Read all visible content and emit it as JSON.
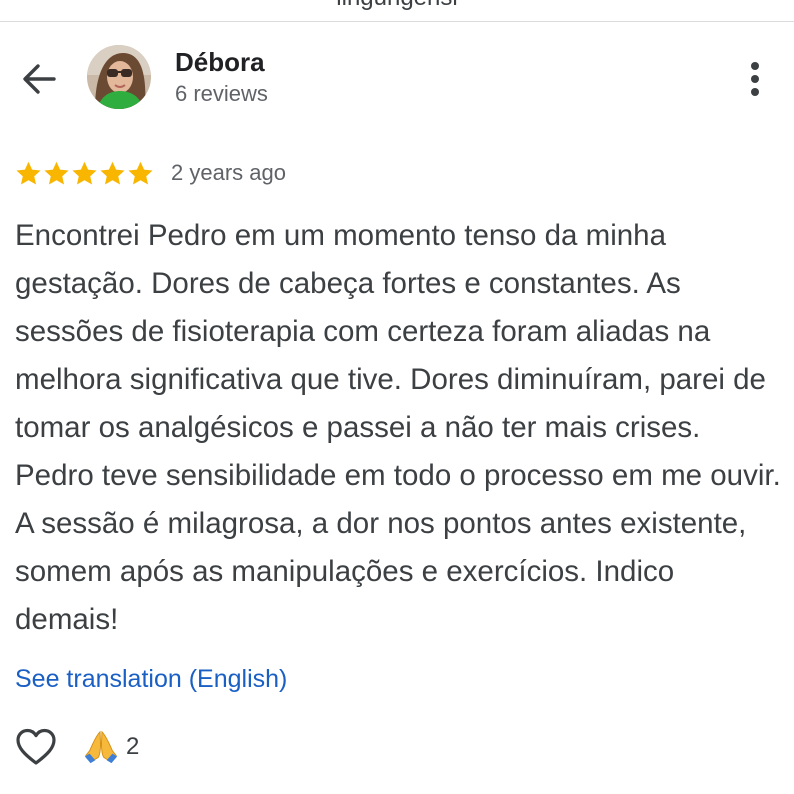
{
  "header": {
    "truncated_text": "lingungensi"
  },
  "reviewer": {
    "name": "Débora",
    "review_count": "6 reviews",
    "avatar_icon": "avatar-photo"
  },
  "review": {
    "rating": 5,
    "rating_max": 5,
    "date": "2 years ago",
    "text": "Encontrei Pedro em um momento tenso da minha gestação. Dores de cabeça fortes e constantes. As sessões de fisioterapia com certeza foram aliadas na melhora significativa que tive. Dores diminuíram, parei de tomar os analgésicos e passei a não ter mais crises. Pedro teve sensibilidade em todo o processo em me ouvir. A sessão é milagrosa, a dor nos pontos antes existente, somem após as manipulações e exercícios. Indico demais!",
    "translate_link": "See translation (English)"
  },
  "reactions": {
    "like_icon": "heart-outline-icon",
    "emoji_icon": "folded-hands-icon",
    "emoji_count": "2"
  },
  "icons": {
    "back": "arrow-left-icon",
    "more": "more-vert-icon",
    "star": "star-icon"
  },
  "colors": {
    "star": "#f9b600",
    "link": "#1a5fc4",
    "text": "#3c4043",
    "secondary_text": "#5f6368"
  }
}
